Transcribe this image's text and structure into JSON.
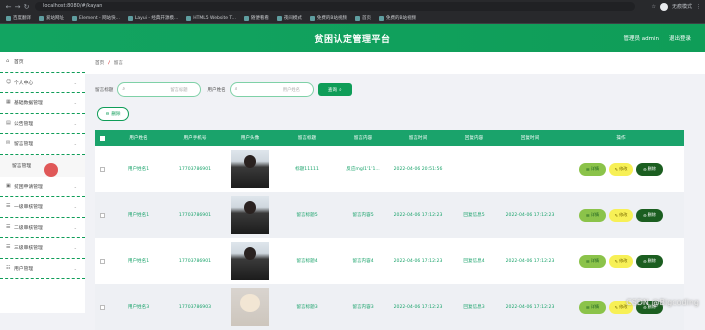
{
  "browser": {
    "url": "localhost:8080/#/kayan",
    "profile": "无痕模式",
    "bookmarks": [
      "百度翻译",
      "爱站网址",
      "Element - 网站快...",
      "Layui - 经典开源模...",
      "HTML5 Website T...",
      "随便看看",
      "夜间模式",
      "免费的B站视频",
      "首页",
      "免费的B站视频"
    ]
  },
  "header": {
    "title": "贫困认定管理平台",
    "admin": "管理员 admin",
    "logout": "退出登录"
  },
  "sidebar": {
    "items": [
      {
        "label": "首页",
        "icon": "home-icon"
      },
      {
        "label": "个人中心",
        "icon": "user-icon"
      },
      {
        "label": "基础数据管理",
        "icon": "grid-icon"
      },
      {
        "label": "公告管理",
        "icon": "notice-icon"
      },
      {
        "label": "留言管理",
        "icon": "message-icon"
      },
      {
        "label": "留言管理",
        "icon": "",
        "sub": true
      },
      {
        "label": "贫困申请管理",
        "icon": "apply-icon"
      },
      {
        "label": "一级审核管理",
        "icon": "review-icon"
      },
      {
        "label": "二级审核管理",
        "icon": "review-icon"
      },
      {
        "label": "三级审核管理",
        "icon": "review-icon"
      },
      {
        "label": "用户管理",
        "icon": "users-icon"
      }
    ]
  },
  "breadcrumb": {
    "home": "首页",
    "current": "留言"
  },
  "filters": {
    "label1": "留言标题",
    "ph1": "留言标题",
    "label2": "用户姓名",
    "ph2": "用户姓名",
    "search": "查询"
  },
  "del_label": "删除",
  "table": {
    "headers": [
      "用户姓名",
      "用户手机号",
      "用户头像",
      "留言标题",
      "留言内容",
      "留言时间",
      "回复内容",
      "回复时间",
      "操作"
    ],
    "rows": [
      {
        "name": "用户姓名1",
        "phone": "17703786901",
        "title": "标题11111",
        "content": "反应mgl1'1'1...",
        "time": "2022-04-06 20:51:56",
        "reply": "",
        "rtime": "",
        "photo": "boy"
      },
      {
        "name": "用户姓名1",
        "phone": "17703786901",
        "title": "留言标题5",
        "content": "留言内容5",
        "time": "2022-04-06 17:12:23",
        "reply": "回复信息5",
        "rtime": "2022-04-06 17:12:23",
        "photo": "boy"
      },
      {
        "name": "用户姓名1",
        "phone": "17703786901",
        "title": "留言标题4",
        "content": "留言内容4",
        "time": "2022-04-06 17:12:23",
        "reply": "回复信息4",
        "rtime": "2022-04-06 17:12:23",
        "photo": "boy"
      },
      {
        "name": "用户姓名3",
        "phone": "17703786903",
        "title": "留言标题3",
        "content": "留言内容3",
        "time": "2022-04-06 17:12:23",
        "reply": "回复信息3",
        "rtime": "2022-04-06 17:12:23",
        "photo": "dog"
      }
    ],
    "ops": {
      "detail": "详情",
      "edit": "修改",
      "delete": "删除"
    }
  },
  "watermark": "CSDN @Bigcoding"
}
